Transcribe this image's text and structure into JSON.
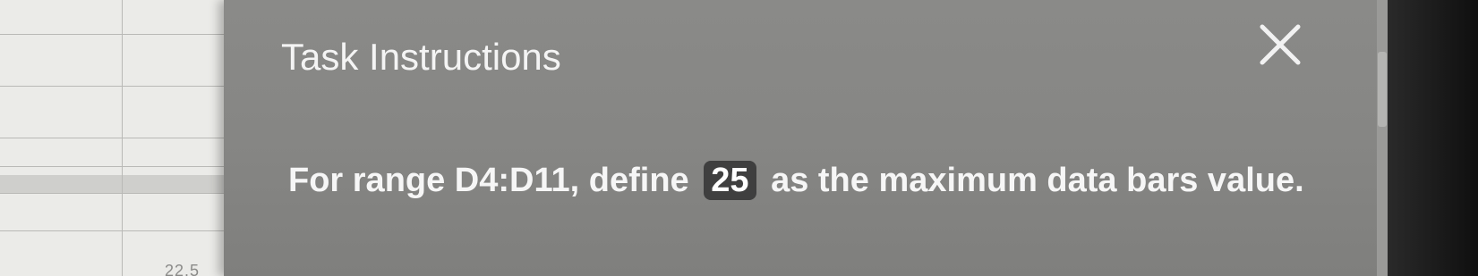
{
  "dialog": {
    "title": "Task Instructions",
    "close_icon": "close-icon",
    "instruction": {
      "prefix": "For range D4:D11, define",
      "value": "25",
      "suffix": "as the maximum data bars value."
    }
  },
  "background_sheet": {
    "partial_cell_text": "22.5"
  },
  "colors": {
    "dialog_bg": "#868684",
    "text": "#f6f6f6",
    "value_box_bg": "#3f3f3f"
  }
}
